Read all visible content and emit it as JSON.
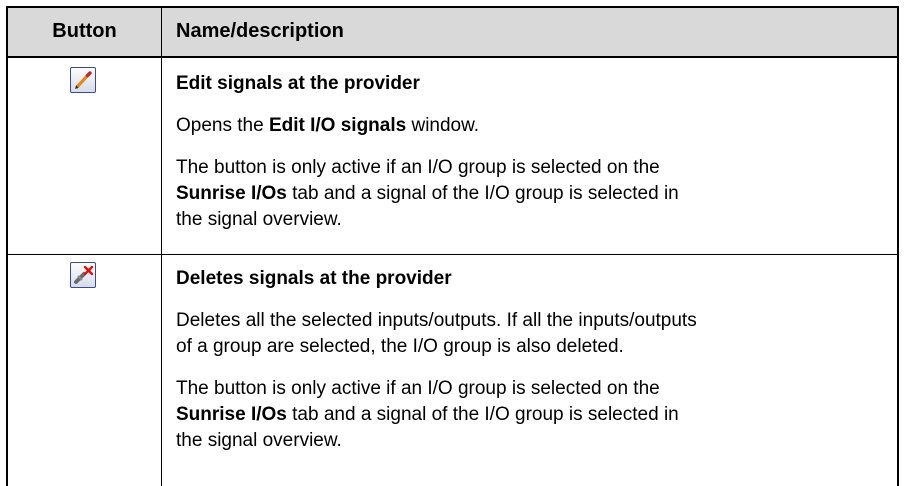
{
  "header": {
    "button_col": "Button",
    "name_col": "Name/description"
  },
  "rows": [
    {
      "icon": "edit-pencil-icon",
      "title": "Edit signals at the provider",
      "para1_a": "Opens the ",
      "para1_b": "Edit I/O signals",
      "para1_c": " window.",
      "para2_a": "The button is only active if an I/O group is selected on the",
      "para2_b": "Sunrise I/Os",
      "para2_c": " tab and a signal of the I/O group is selected in",
      "para2_d": "the signal overview."
    },
    {
      "icon": "delete-signal-icon",
      "title": "Deletes signals at the provider",
      "para1_a": "Deletes all the selected inputs/outputs. If all the inputs/outputs",
      "para1_b": "of a group are selected, the I/O group is also deleted.",
      "para2_a": "The button is only active if an I/O group is selected on the",
      "para2_b": "Sunrise I/Os",
      "para2_c": " tab and a signal of the I/O group is selected in",
      "para2_d": "the signal overview."
    }
  ]
}
